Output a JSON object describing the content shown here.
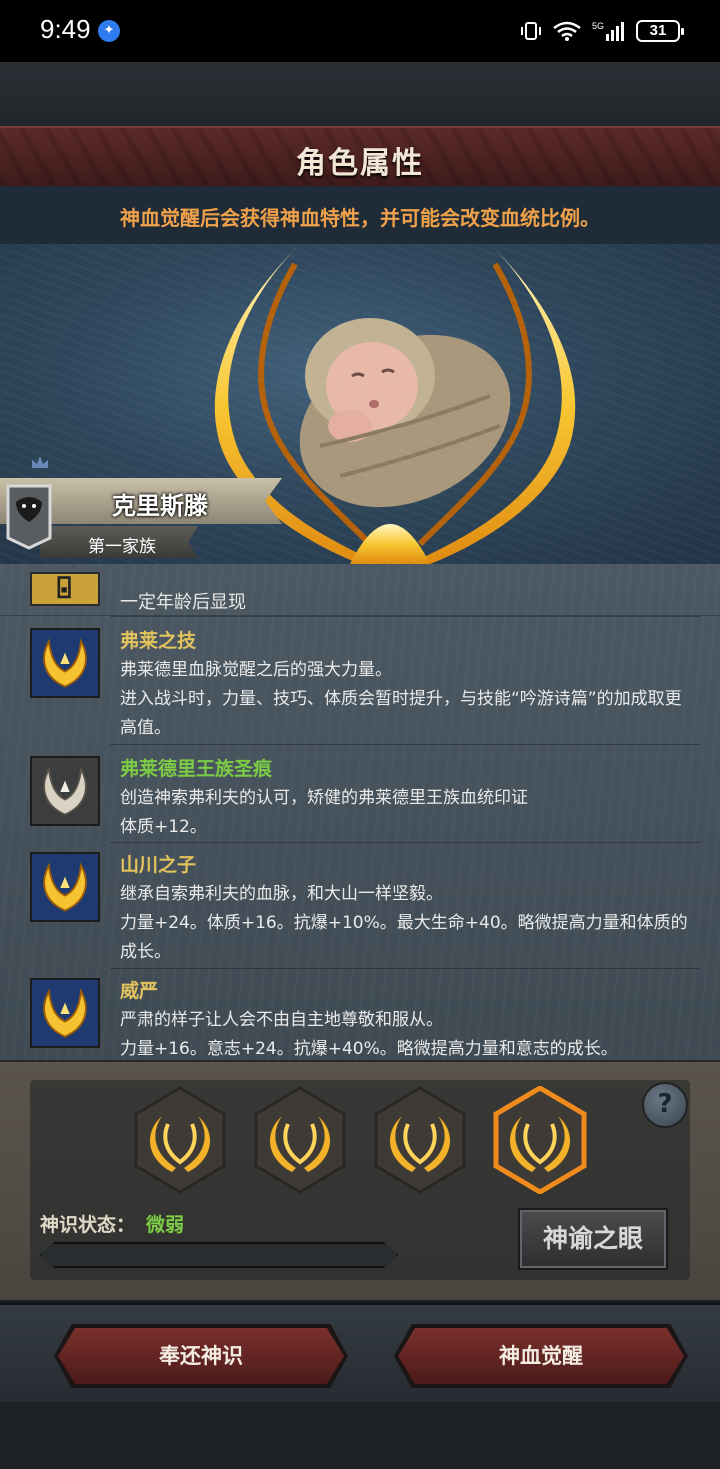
{
  "status_bar": {
    "time": "9:49",
    "battery": "31",
    "network": "5G"
  },
  "header": {
    "title": "角色属性",
    "subtitle": "神血觉醒后会获得神血特性，并可能会改变血统比例。"
  },
  "character": {
    "name": "克里斯滕",
    "family": "第一家族"
  },
  "traits": {
    "locked_text": "一定年龄后显现",
    "items": [
      {
        "name": "弗莱之技",
        "icon": "golden-crown-icon",
        "desc1": "弗莱德里血脉觉醒之后的强大力量。",
        "desc2": "进入战斗时，力量、技巧、体质会暂时提升，与技能“吟游诗篇”的加成取更高值。"
      },
      {
        "name": "弗莱德里王族圣痕",
        "icon": "silver-crown-icon",
        "desc1": "创造神索弗利夫的认可，矫健的弗莱德里王族血统印证",
        "desc2": "体质+12。"
      },
      {
        "name": "山川之子",
        "icon": "golden-crown-icon",
        "desc1": "继承自索弗利夫的血脉，和大山一样坚毅。",
        "desc2": "力量+24。体质+16。抗爆+10%。最大生命+40。略微提高力量和体质的成长。"
      },
      {
        "name": "威严",
        "icon": "golden-crown-icon",
        "desc1": "严肃的样子让人会不由自主地尊敬和服从。",
        "desc2": "力量+16。意志+24。抗爆+40%。略微提高力量和意志的成长。"
      }
    ]
  },
  "panel": {
    "status_label": "神识状态：",
    "status_value": "微弱",
    "progress_fraction": 0.0,
    "oracle_button": "神谕之眼",
    "help": "?"
  },
  "buttons": {
    "return": "奉还神识",
    "awaken": "神血觉醒"
  },
  "colors": {
    "accent_gold": "#e3c35c",
    "accent_green": "#7ccc45",
    "subtitle_orange": "#f0a14a",
    "button_red": "#7a2f2c"
  }
}
